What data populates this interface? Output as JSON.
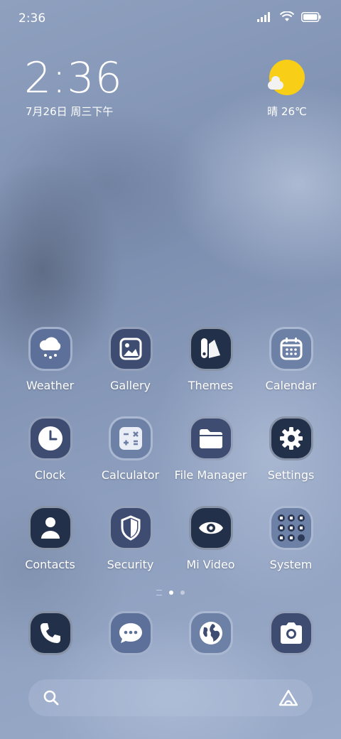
{
  "status_bar": {
    "time": "2:36"
  },
  "lock_clock": {
    "time": "2:36",
    "date": "7月26日 周三下午"
  },
  "weather_widget": {
    "condition": "晴",
    "temperature": "26℃"
  },
  "apps": [
    {
      "label": "Weather",
      "icon": "weather-icon"
    },
    {
      "label": "Gallery",
      "icon": "gallery-icon"
    },
    {
      "label": "Themes",
      "icon": "themes-icon"
    },
    {
      "label": "Calendar",
      "icon": "calendar-icon"
    },
    {
      "label": "Clock",
      "icon": "clock-icon"
    },
    {
      "label": "Calculator",
      "icon": "calculator-icon"
    },
    {
      "label": "File Manager",
      "icon": "folder-icon"
    },
    {
      "label": "Settings",
      "icon": "gear-icon"
    },
    {
      "label": "Contacts",
      "icon": "person-icon"
    },
    {
      "label": "Security",
      "icon": "shield-icon"
    },
    {
      "label": "Mi Video",
      "icon": "eye-icon"
    },
    {
      "label": "System",
      "icon": "folder-grid-icon"
    }
  ],
  "dock": [
    {
      "icon": "phone-icon"
    },
    {
      "icon": "message-icon"
    },
    {
      "icon": "browser-globe-icon"
    },
    {
      "icon": "camera-icon"
    }
  ],
  "pager": {
    "pages": 2,
    "active": 1
  },
  "colors": {
    "sun": "#f8cf16",
    "icon_dark": "#233049",
    "icon_mid": "#3d4c70",
    "icon_light": "#5d7099"
  }
}
